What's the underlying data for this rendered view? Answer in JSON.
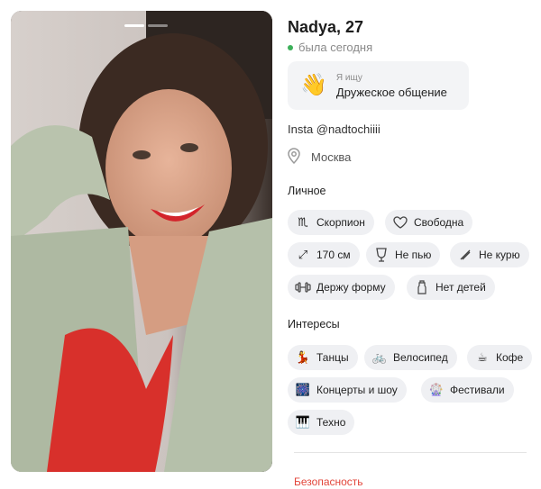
{
  "profile": {
    "name_age": "Nadya, 27",
    "status": "была сегодня",
    "seeking_small": "Я ищу",
    "seeking_value": "Дружеское общение",
    "seeking_emoji": "👋",
    "instagram": "Insta @nadtochiiii",
    "location": "Москва"
  },
  "sections": {
    "personal": "Личное",
    "interests": "Интересы",
    "safety": "Безопасность"
  },
  "personal_chips": [
    {
      "icon": "scorpio-icon",
      "label": "Скорпион"
    },
    {
      "icon": "heart-icon",
      "label": "Свободна"
    },
    {
      "icon": "height-icon",
      "label": "170 см"
    },
    {
      "icon": "glass-icon",
      "label": "Не пью"
    },
    {
      "icon": "no-smoking-icon",
      "label": "Не курю"
    },
    {
      "icon": "dumbbell-icon",
      "label": "Держу форму"
    },
    {
      "icon": "baby-bottle-icon",
      "label": "Нет детей"
    }
  ],
  "interest_chips": [
    {
      "icon": "dance-icon",
      "glyph": "💃",
      "label": "Танцы"
    },
    {
      "icon": "bicycle-icon",
      "glyph": "🚲",
      "label": "Велосипед"
    },
    {
      "icon": "coffee-icon",
      "glyph": "☕",
      "label": "Кофе"
    },
    {
      "icon": "fireworks-icon",
      "glyph": "🎆",
      "label": "Концерты и шоу"
    },
    {
      "icon": "ferris-wheel-icon",
      "glyph": "🎡",
      "label": "Фестивали"
    },
    {
      "icon": "piano-icon",
      "glyph": "🎹",
      "label": "Техно"
    }
  ],
  "colors": {
    "online": "#3db05a",
    "chip_bg": "#eff0f3",
    "accent_red": "#e2453a"
  }
}
